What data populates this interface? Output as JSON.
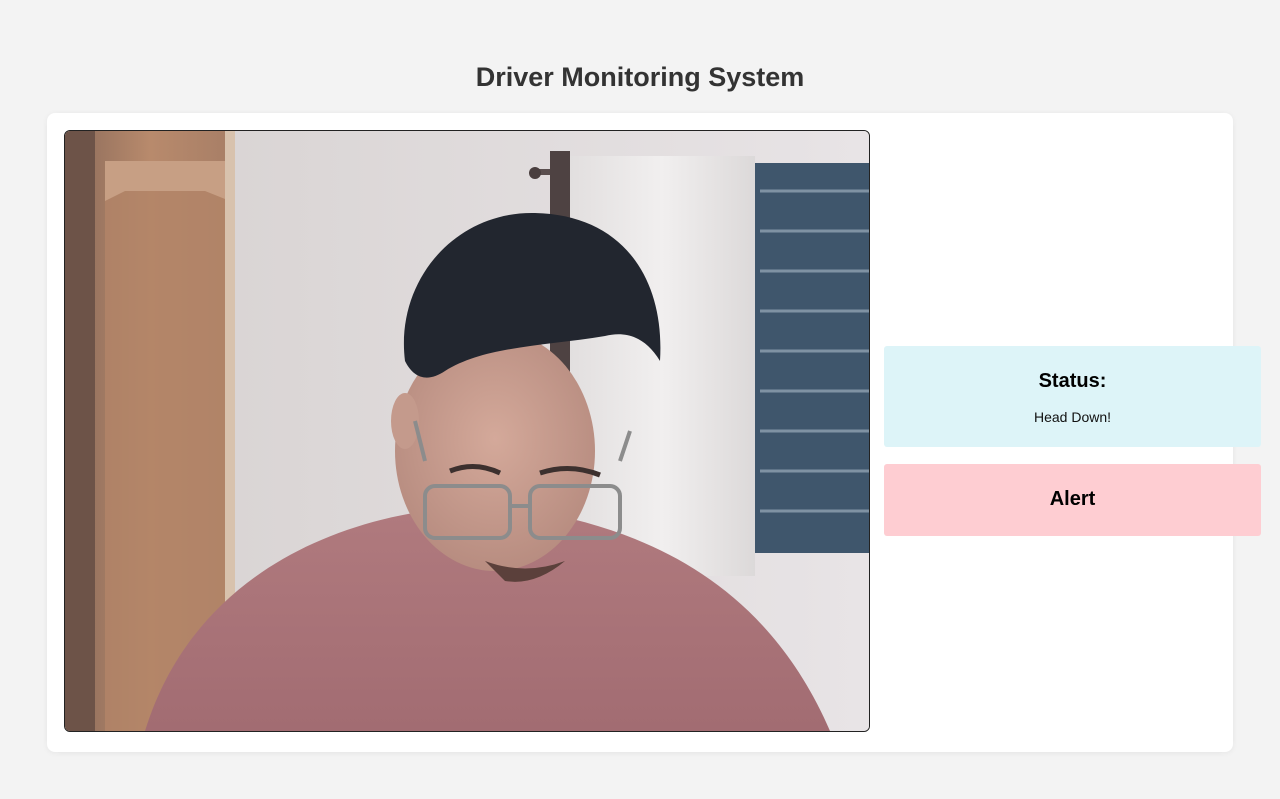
{
  "header": {
    "title": "Driver Monitoring System"
  },
  "camera": {
    "description_icon": "webcam-feed"
  },
  "status": {
    "heading": "Status:",
    "value": "Head Down!",
    "background_color": "#ddf4f8"
  },
  "alert": {
    "heading": "Alert",
    "background_color": "#fecdd2"
  }
}
